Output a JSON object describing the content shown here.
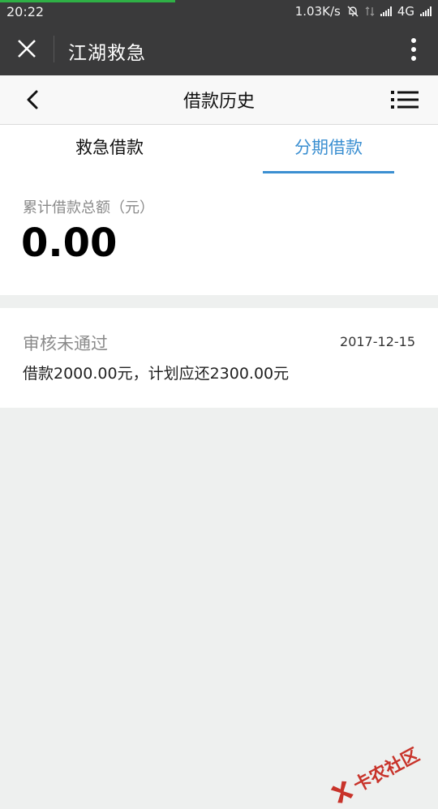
{
  "status_bar": {
    "time": "20:22",
    "speed": "1.03K/s",
    "network": "4G",
    "progress": 0.4
  },
  "wechat_bar": {
    "title": "江湖救急",
    "close_icon": "close-icon",
    "more_icon": "more-vertical-icon"
  },
  "nav": {
    "title": "借款历史",
    "back_icon": "back-icon",
    "menu_icon": "list-menu-icon"
  },
  "tabs": [
    {
      "label": "救急借款",
      "active": false
    },
    {
      "label": "分期借款",
      "active": true
    }
  ],
  "summary": {
    "label": "累计借款总额（元）",
    "amount": "0.00"
  },
  "records": [
    {
      "status": "审核未通过",
      "date": "2017-12-15",
      "description": "借款2000.00元，计划应还2300.00元"
    }
  ],
  "watermark": {
    "text": "卡农社区"
  },
  "colors": {
    "accent": "#3b8fd1",
    "bar": "#3a3a3b",
    "page_bg": "#eef0ef",
    "watermark": "#c8332a"
  }
}
